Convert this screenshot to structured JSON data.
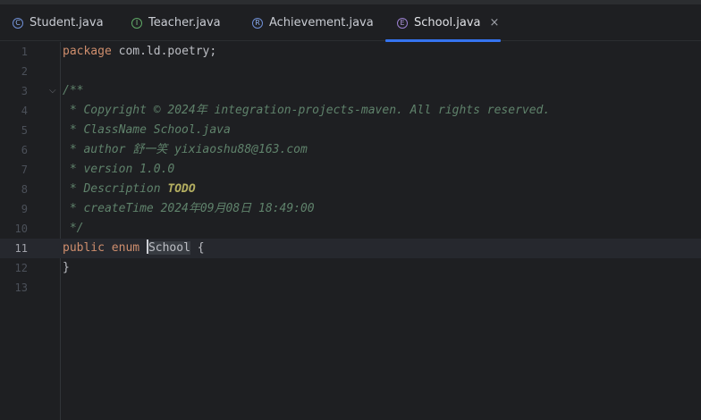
{
  "tabs": [
    {
      "label": "Student.java",
      "icon": "C",
      "kind": "class"
    },
    {
      "label": "Teacher.java",
      "icon": "I",
      "kind": "interface"
    },
    {
      "label": "Achievement.java",
      "icon": "R",
      "kind": "record"
    },
    {
      "label": "School.java",
      "icon": "E",
      "kind": "enum",
      "active": true,
      "close": "×"
    }
  ],
  "lines": {
    "n1": "1",
    "n2": "2",
    "n3": "3",
    "n4": "4",
    "n5": "5",
    "n6": "6",
    "n7": "7",
    "n8": "8",
    "n9": "9",
    "n10": "10",
    "n11": "11",
    "n12": "12",
    "n13": "13"
  },
  "code": {
    "l1_kw": "package",
    "l1_rest": " com.ld.poetry;",
    "l3": "/**",
    "l4": " * Copyright © 2024年 integration-projects-maven. All rights reserved.",
    "l5": " * ClassName School.java",
    "l6": " * author 舒一笑 yixiaoshu88@163.com",
    "l7": " * version 1.0.0",
    "l8_pre": " * Description ",
    "l8_todo": "TODO",
    "l9": " * createTime 2024年09月08日 18:49:00",
    "l10": " */",
    "l11_kw1": "public",
    "l11_kw2": "enum",
    "l11_name": "School",
    "l11_rest": " {",
    "l12": "}"
  },
  "colors": {
    "background": "#1e1f22",
    "keyword": "#cf8e6d",
    "doc_comment": "#5f826b",
    "todo": "#b3ae60",
    "active_tab_underline": "#3574f0"
  }
}
